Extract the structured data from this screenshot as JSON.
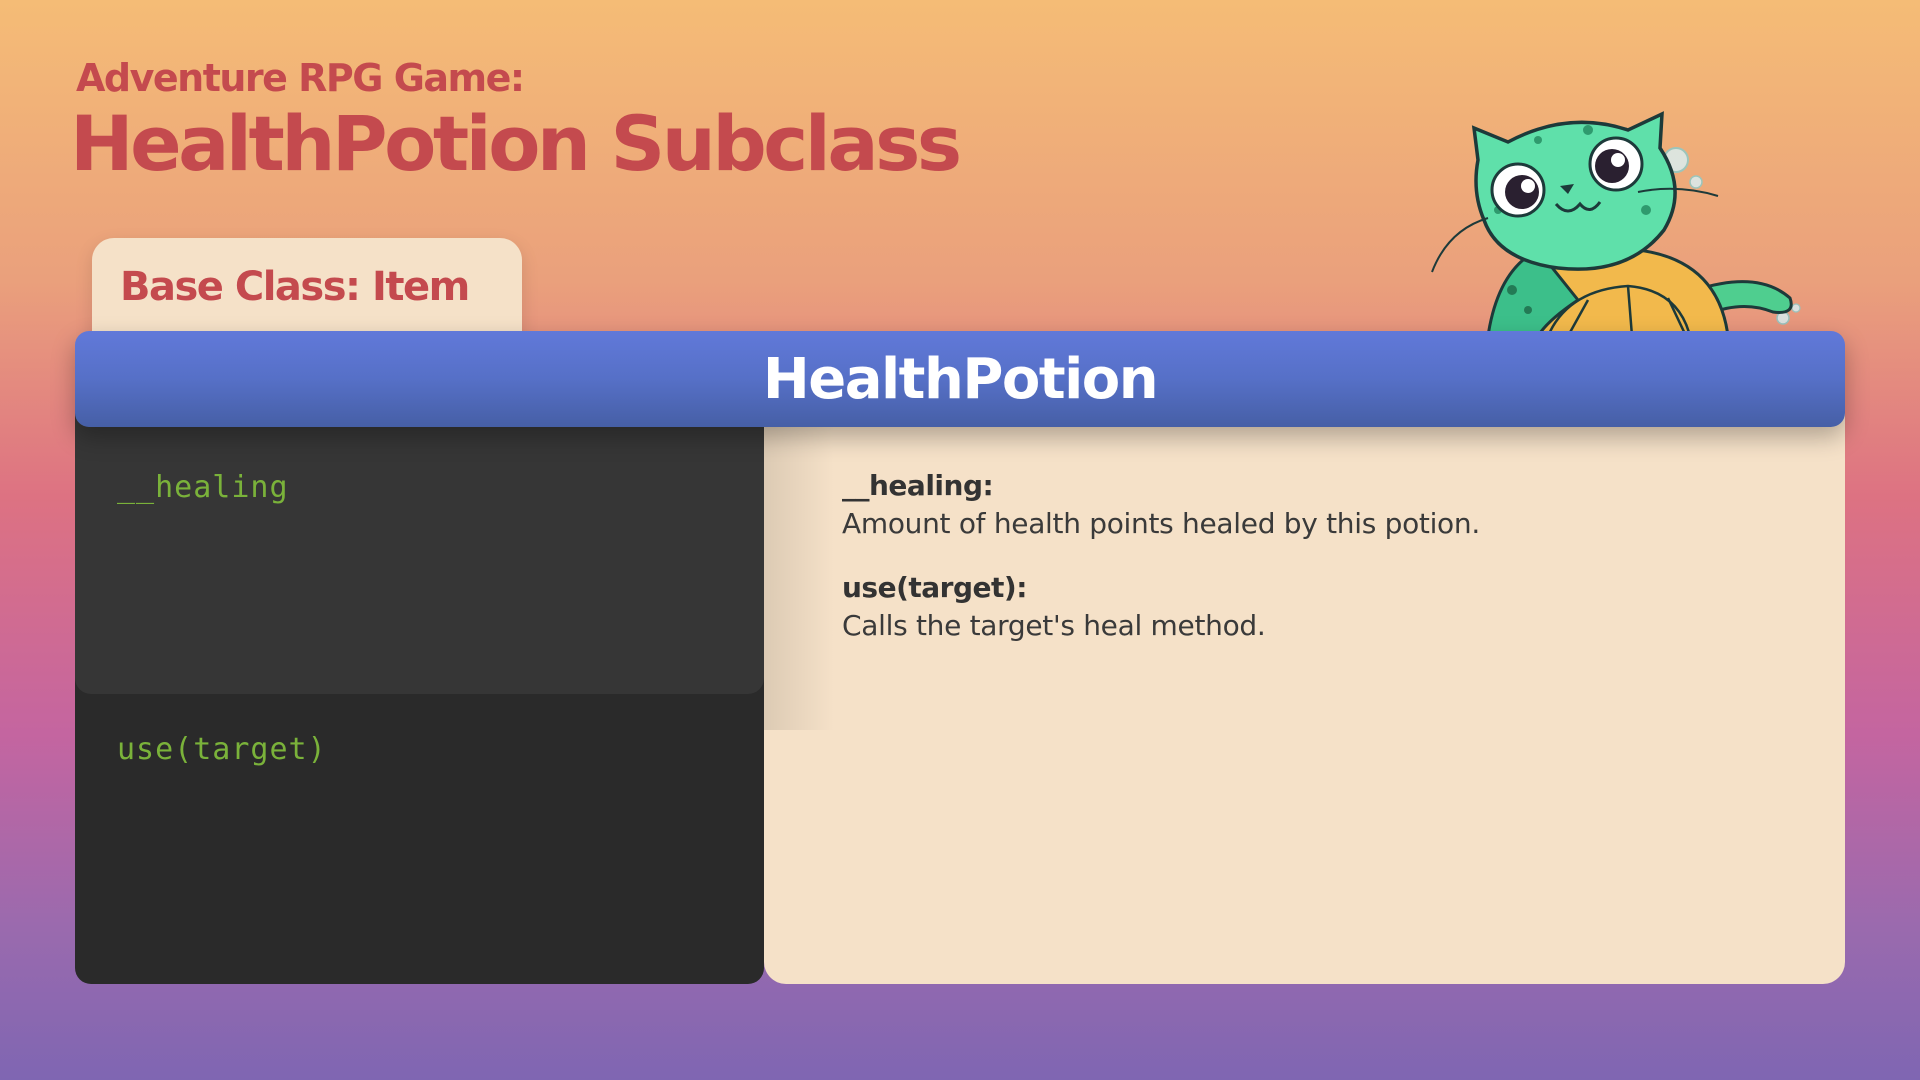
{
  "header": {
    "subtitle": "Adventure RPG Game:",
    "title": "HealthPotion Subclass"
  },
  "base_class": {
    "label": "Base Class: Item"
  },
  "class_box": {
    "class_name": "HealthPotion",
    "attributes": [
      "__healing"
    ],
    "methods": [
      "use(target)"
    ],
    "descriptions": [
      {
        "name": "__healing:",
        "text": "Amount of health points healed by this potion."
      },
      {
        "name": "use(target):",
        "text": "Calls the target's heal method."
      }
    ]
  },
  "mascot": {
    "icon": "cat-turtle-mascot-icon"
  },
  "colors": {
    "title_red": "#c44a4e",
    "header_blue": "#5670c7",
    "code_green": "#7ab23a",
    "panel_cream": "#f5e1c8",
    "panel_dark": "#2a2a2a"
  }
}
